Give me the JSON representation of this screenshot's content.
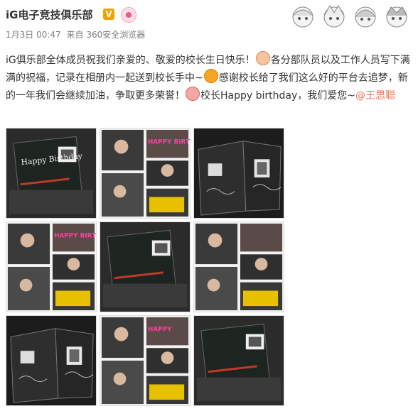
{
  "post": {
    "author": "iG电子竞技俱乐部",
    "verified_badge": "V",
    "date": "1月3日",
    "time": "00:47",
    "source_prefix": "来自",
    "source": "360安全浏览器",
    "text_1": "iG俱乐部全体成员祝我们亲爱的、敬爱的校长生日快乐！",
    "text_2": "各分部队员以及工作人员写下满满的祝福，记录在相册内一起送到校长手中~",
    "text_3": "感谢校长给了我们这么好的平台去追梦，新的一年我们会继续加油，争取更多荣誉！",
    "text_4": "校长Happy birthday，我们爱您~",
    "mention": "@王思聪",
    "emoji_1": "cake-emoji",
    "emoji_2": "heart-eyes-emoji",
    "emoji_3": "cheer-emoji"
  },
  "photos": [
    {
      "name": "photo-album-happy-birthday-card",
      "scene": "chalkboard-card",
      "card_text": "Happy Birthday"
    },
    {
      "name": "photo-collage-writing",
      "scene": "collage",
      "card_text": "HAPPY BIRTHDAY"
    },
    {
      "name": "photo-album-open-pages",
      "scene": "album",
      "card_text": ""
    },
    {
      "name": "photo-collage-players-writing",
      "scene": "collage",
      "card_text": "HAPPY BIRTHDAY"
    },
    {
      "name": "photo-album-drawings",
      "scene": "chalkboard-card",
      "card_text": ""
    },
    {
      "name": "photo-collage-team",
      "scene": "collage",
      "card_text": ""
    },
    {
      "name": "photo-album-pages-dark",
      "scene": "album",
      "card_text": ""
    },
    {
      "name": "photo-collage-staff-writing",
      "scene": "collage",
      "card_text": "HAPPY"
    },
    {
      "name": "photo-album-handwritten",
      "scene": "chalkboard-card",
      "card_text": ""
    }
  ],
  "colors": {
    "text": "#333333",
    "meta": "#808080",
    "mention": "#eb7350",
    "badge": "#f2a100"
  }
}
